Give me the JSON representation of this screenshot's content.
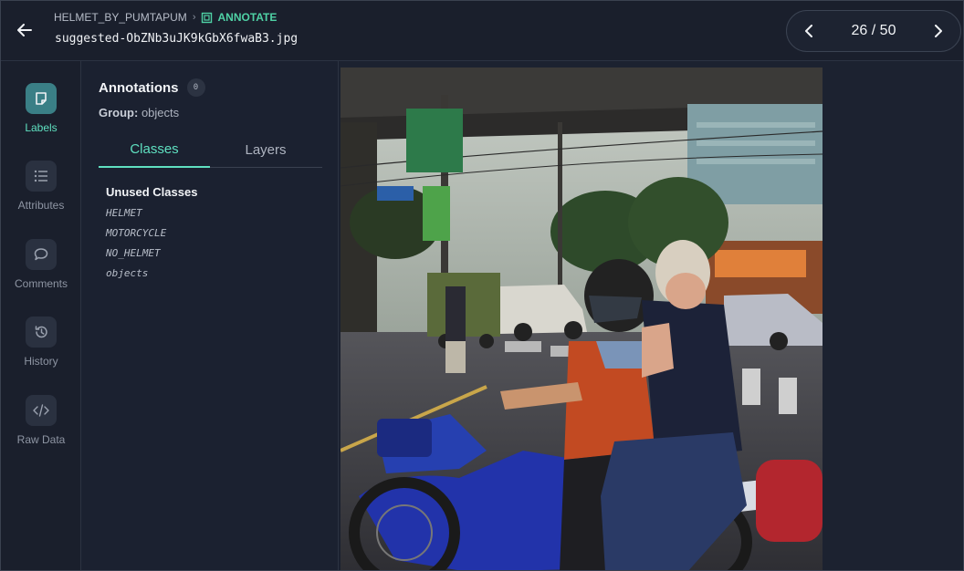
{
  "header": {
    "dataset": "HELMET_BY_PUMTAPUM",
    "mode": "ANNOTATE",
    "filename": "suggested-ObZNb3uJK9kGbX6fwaB3.jpg"
  },
  "pager": {
    "label": "26 / 50"
  },
  "rail": {
    "items": [
      {
        "label": "Labels",
        "icon": "note-icon"
      },
      {
        "label": "Attributes",
        "icon": "list-icon"
      },
      {
        "label": "Comments",
        "icon": "speech-bubble-icon"
      },
      {
        "label": "History",
        "icon": "history-icon"
      },
      {
        "label": "Raw Data",
        "icon": "code-icon"
      }
    ]
  },
  "panel": {
    "title": "Annotations",
    "count": "0",
    "group_label": "Group:",
    "group_value": "objects",
    "tabs": [
      {
        "label": "Classes",
        "active": true
      },
      {
        "label": "Layers",
        "active": false
      }
    ],
    "unused_title": "Unused Classes",
    "classes": [
      "HELMET",
      "MOTORCYCLE",
      "NO_HELMET",
      "objects"
    ]
  },
  "colors": {
    "accent": "#5fe0c0",
    "annotate": "#4fd1a5",
    "background": "#1b2130"
  }
}
